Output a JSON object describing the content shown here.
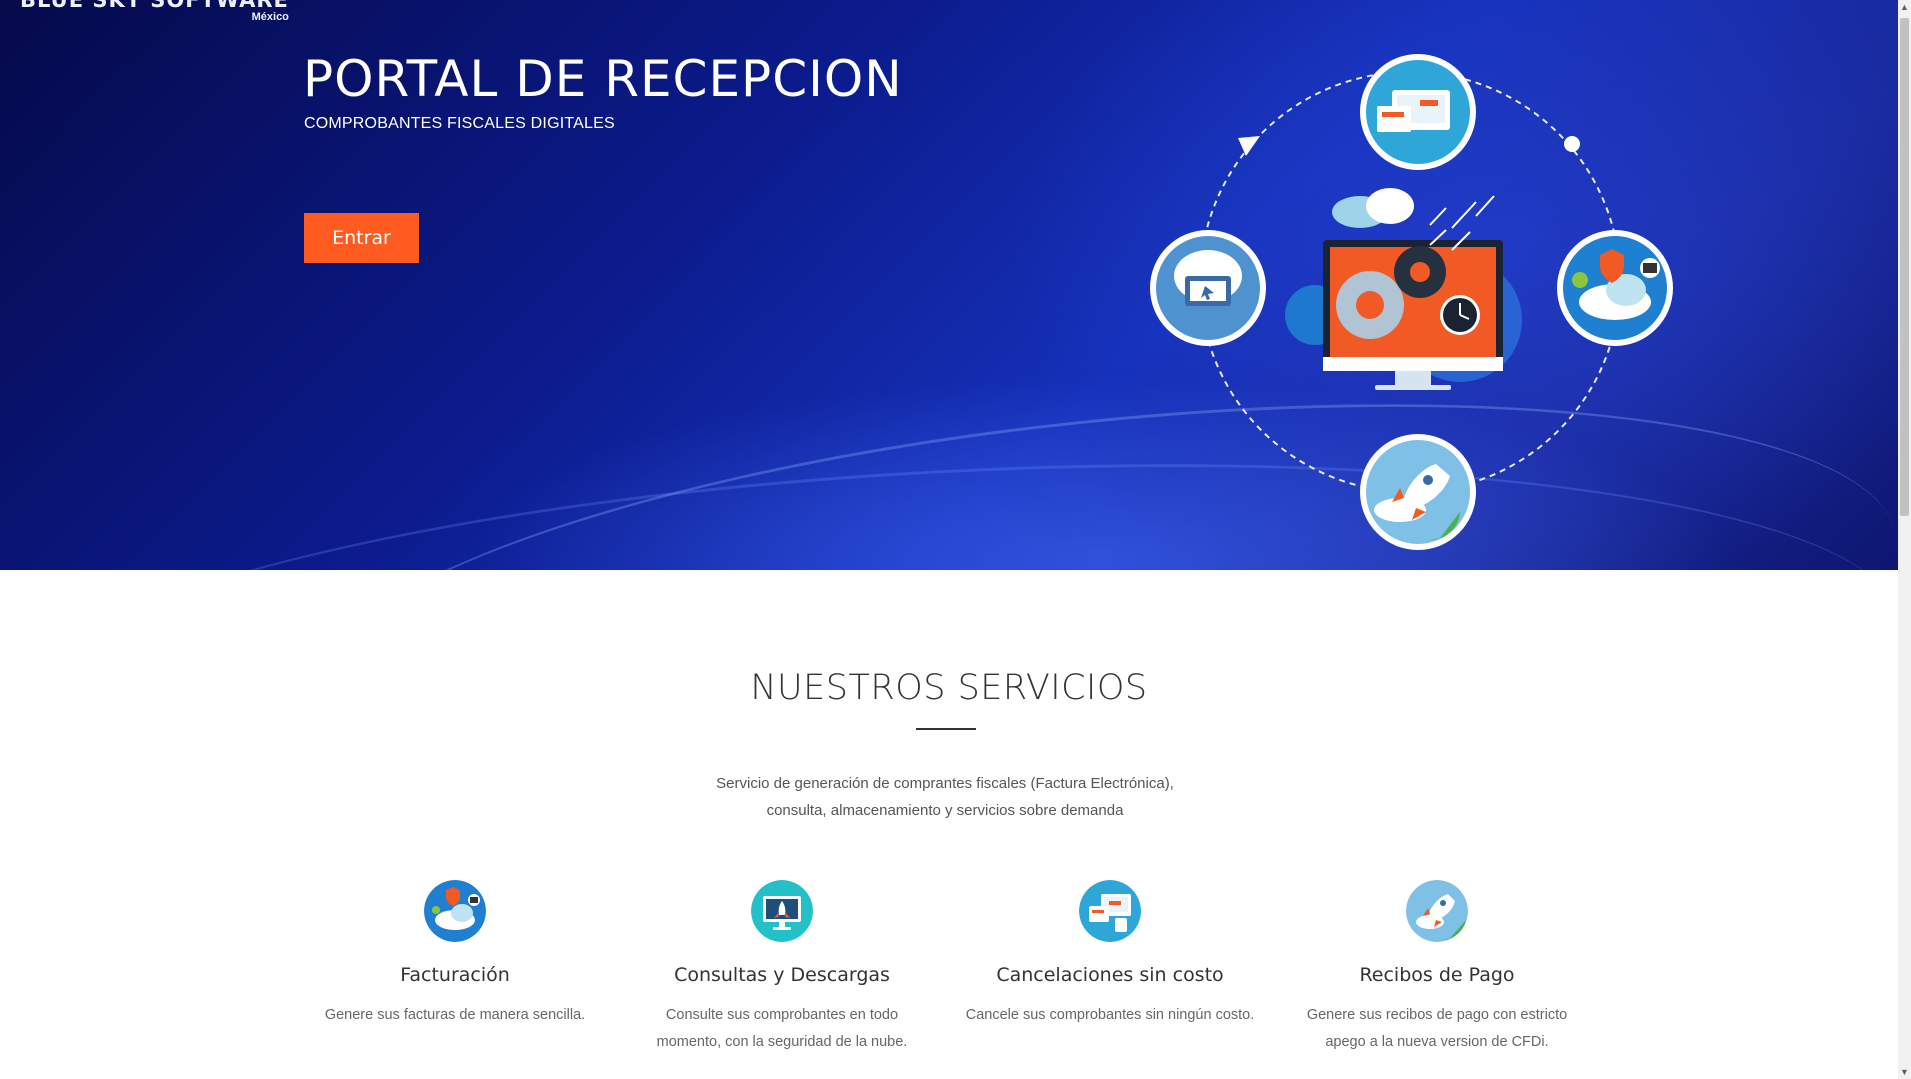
{
  "brand": {
    "name": "BLUE SKY SOFTWARE",
    "sub": "México"
  },
  "hero": {
    "title": "PORTAL DE RECEPCION",
    "subtitle": "COMPROBANTES FISCALES DIGITALES",
    "enter_label": "Entrar"
  },
  "services": {
    "title": "NUESTROS SERVICIOS",
    "description_line1": "Servicio de generación de comprantes fiscales (Factura Electrónica),",
    "description_line2": "consulta, almacenamiento y servicios sobre demanda",
    "items": [
      {
        "icon": "cloud-shield-icon",
        "title": "Facturación",
        "text": "Genere sus facturas de manera sencilla."
      },
      {
        "icon": "monitor-rocket-icon",
        "title": "Consultas y Descargas",
        "text": "Consulte sus comprobantes en todo momento, con la seguridad de la nube."
      },
      {
        "icon": "devices-icon",
        "title": "Cancelaciones sin costo",
        "text": "Cancele sus comprobantes sin ningún costo."
      },
      {
        "icon": "rocket-icon",
        "title": "Recibos de Pago",
        "text": "Genere sus recibos de pago con estricto apego a la nueva version de CFDi."
      }
    ]
  },
  "colors": {
    "accent": "#ff5a1f",
    "hero_dark": "#050a4a",
    "hero_mid": "#1530b8"
  }
}
